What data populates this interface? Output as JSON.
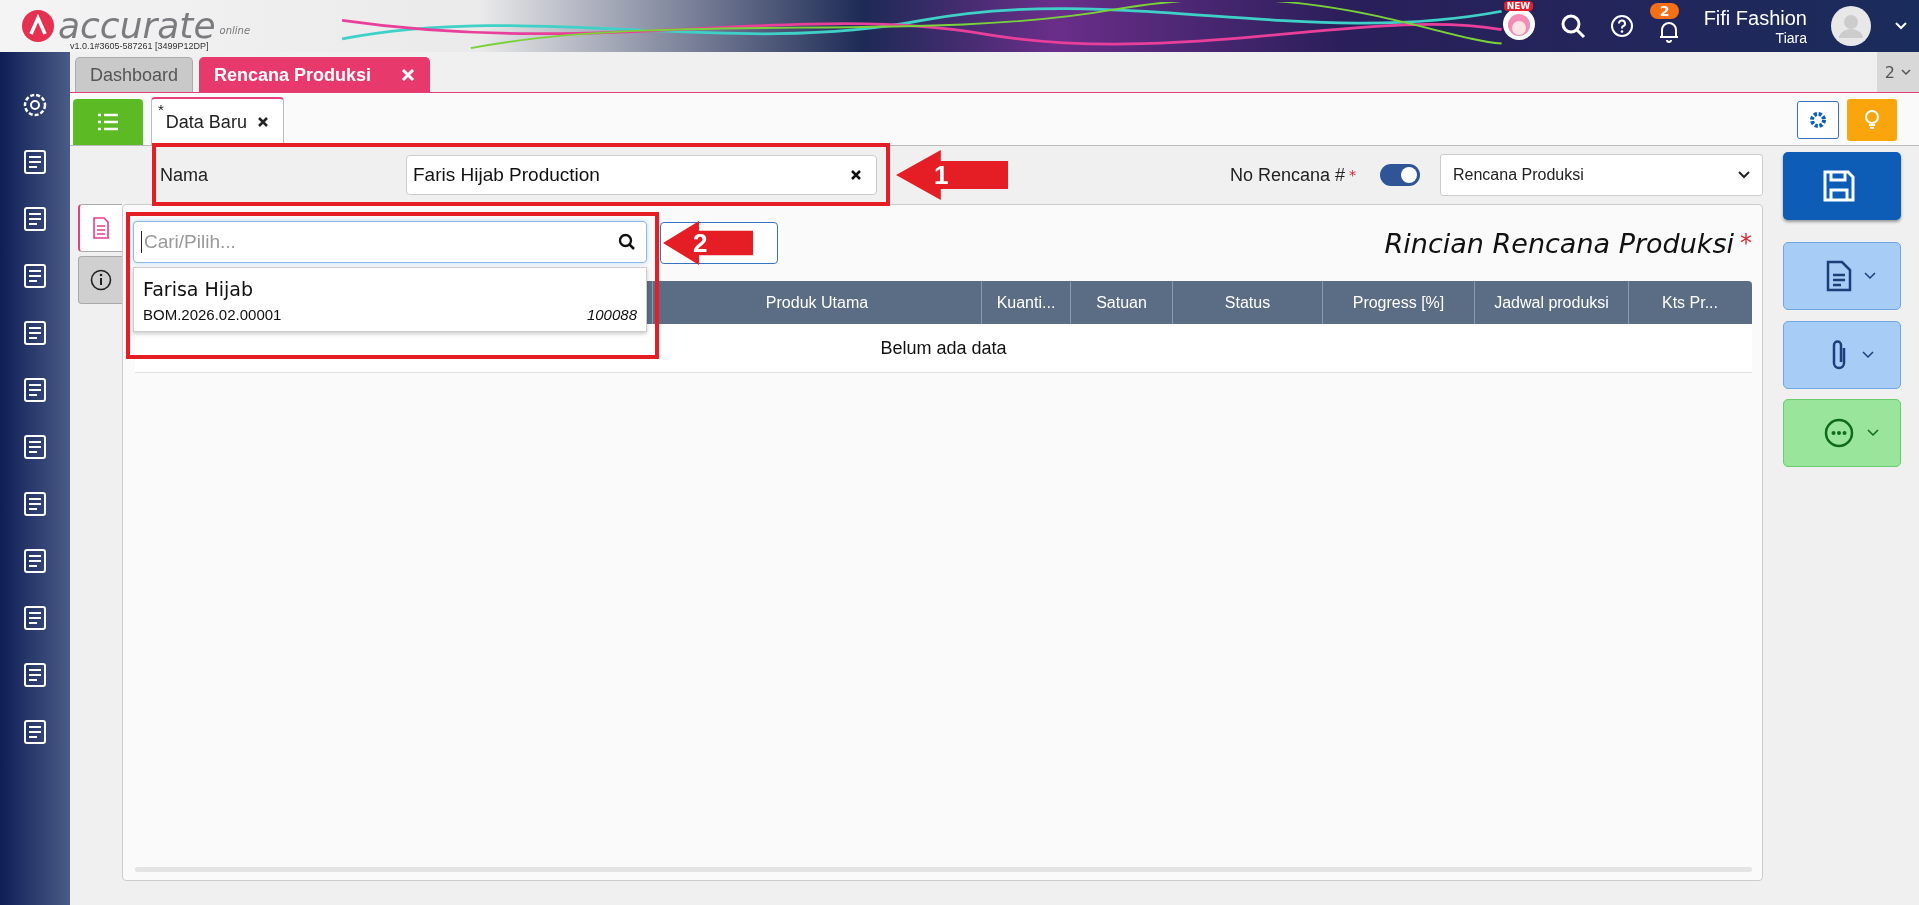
{
  "app": {
    "logo": "accurate",
    "logo_sub": "online",
    "version": "v1.0.1#3605-587261 [3499P12DP]"
  },
  "header": {
    "new_badge": "NEW",
    "notification_count": "2",
    "company": "Fifi Fashion",
    "user": "Tiara"
  },
  "tabs": [
    {
      "label": "Dashboard",
      "selected": false,
      "closable": false
    },
    {
      "label": "Rencana Produksi",
      "selected": true,
      "closable": true
    }
  ],
  "tab_overflow": "2",
  "sub_tabs": [
    {
      "label": "Data Baru",
      "marker": "*"
    }
  ],
  "form": {
    "name_label": "Nama",
    "name_value": "Faris Hijab Production",
    "number_label": "No Rencana #",
    "required_mark": "*",
    "auto_number_on": true,
    "number_type": "Rencana Produksi"
  },
  "side_tabs": [
    {
      "kind": "detail",
      "selected": true
    },
    {
      "kind": "info",
      "selected": false
    }
  ],
  "detail": {
    "title": "Rincian Rencana Produksi",
    "required_mark": "*",
    "search": {
      "placeholder": "Cari/Pilih..."
    },
    "suggestions": [
      {
        "name": "Farisa Hijab",
        "code": "BOM.2026.02.00001",
        "number": "100088"
      }
    ],
    "columns": [
      "Produk Utama",
      "Kuanti...",
      "Satuan",
      "Status",
      "Progress [%]",
      "Jadwal produksi",
      "Kts Pr..."
    ],
    "empty_text": "Belum ada data"
  },
  "annotations": [
    {
      "label": "1"
    },
    {
      "label": "2"
    }
  ]
}
